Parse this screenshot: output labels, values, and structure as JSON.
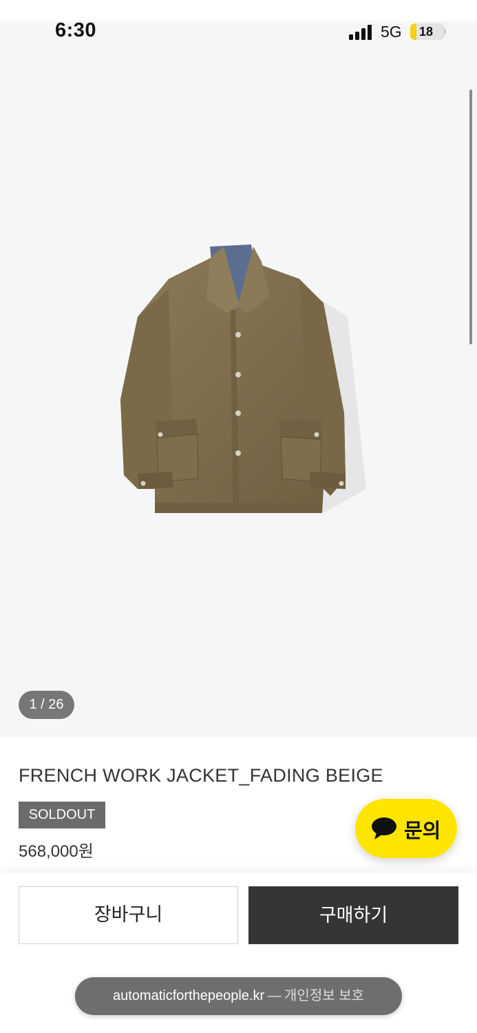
{
  "status_bar": {
    "time": "6:30",
    "network": "5G",
    "battery_level": "18",
    "battery_fraction": 0.18,
    "signal_bars": 4
  },
  "gallery": {
    "counter": "1 / 26",
    "image": "jacket-photo"
  },
  "product": {
    "title": "FRENCH WORK JACKET_FADING BEIGE",
    "status_badge": "SOLDOUT",
    "price": "568,000원"
  },
  "chat": {
    "label": "문의",
    "icon": "speech-bubble-icon",
    "color": "#fee500"
  },
  "actions": {
    "cart_label": "장바구니",
    "buy_label": "구매하기",
    "buy_color": "#353535"
  },
  "browser": {
    "domain": "automaticforthepeople.kr",
    "separator": "—",
    "privacy_note": "개인정보 보호"
  }
}
